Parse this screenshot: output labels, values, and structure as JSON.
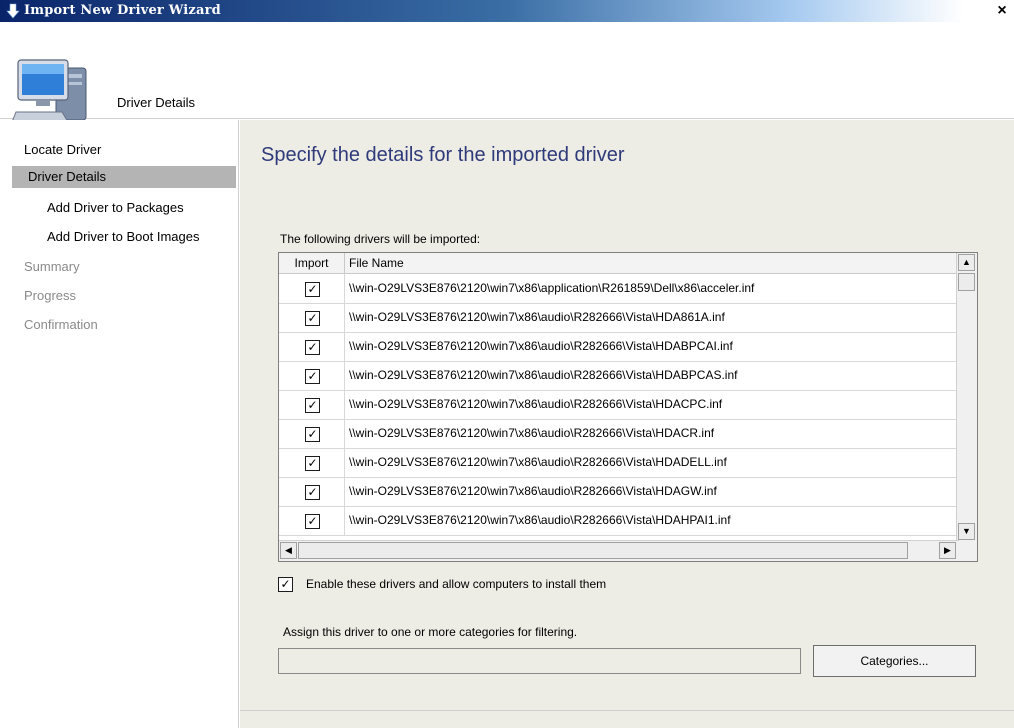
{
  "window": {
    "title": "Import New Driver Wizard",
    "close_glyph": "×",
    "title_icon": "arrow-icon"
  },
  "header": {
    "title": "Driver Details",
    "icon": "computer-icon"
  },
  "sidebar": {
    "items": [
      {
        "label": "Locate Driver",
        "state": "done"
      },
      {
        "label": "Driver Details",
        "state": "selected"
      },
      {
        "label": "Add Driver to Packages",
        "state": "pending"
      },
      {
        "label": "Add Driver to Boot Images",
        "state": "pending"
      },
      {
        "label": "Summary",
        "state": "disabled"
      },
      {
        "label": "Progress",
        "state": "disabled"
      },
      {
        "label": "Confirmation",
        "state": "disabled"
      }
    ]
  },
  "main": {
    "heading": "Specify the details for the imported driver",
    "drivers_label": "The following drivers will be imported:",
    "table": {
      "columns": [
        "Import",
        "File Name"
      ],
      "rows": [
        {
          "checked": "✓",
          "file": "\\\\win-O29LVS3E876\\2120\\win7\\x86\\application\\R261859\\Dell\\x86\\acceler.inf"
        },
        {
          "checked": "✓",
          "file": "\\\\win-O29LVS3E876\\2120\\win7\\x86\\audio\\R282666\\Vista\\HDA861A.inf"
        },
        {
          "checked": "✓",
          "file": "\\\\win-O29LVS3E876\\2120\\win7\\x86\\audio\\R282666\\Vista\\HDABPCAI.inf"
        },
        {
          "checked": "✓",
          "file": "\\\\win-O29LVS3E876\\2120\\win7\\x86\\audio\\R282666\\Vista\\HDABPCAS.inf"
        },
        {
          "checked": "✓",
          "file": "\\\\win-O29LVS3E876\\2120\\win7\\x86\\audio\\R282666\\Vista\\HDACPC.inf"
        },
        {
          "checked": "✓",
          "file": "\\\\win-O29LVS3E876\\2120\\win7\\x86\\audio\\R282666\\Vista\\HDACR.inf"
        },
        {
          "checked": "✓",
          "file": "\\\\win-O29LVS3E876\\2120\\win7\\x86\\audio\\R282666\\Vista\\HDADELL.inf"
        },
        {
          "checked": "✓",
          "file": "\\\\win-O29LVS3E876\\2120\\win7\\x86\\audio\\R282666\\Vista\\HDAGW.inf"
        },
        {
          "checked": "✓",
          "file": "\\\\win-O29LVS3E876\\2120\\win7\\x86\\audio\\R282666\\Vista\\HDAHPAI1.inf"
        }
      ]
    },
    "scroll": {
      "up": "▲",
      "down": "▼",
      "left": "◀",
      "right": "▶"
    },
    "enable_checkbox": {
      "checked": "✓",
      "label": "Enable these drivers and allow computers to install them"
    },
    "assign_label": "Assign this driver to one or more categories for filtering.",
    "categories_value": "",
    "categories_button": "Categories..."
  },
  "colors": {
    "titlebar_start": "#0a246a",
    "heading": "#2e3a7a",
    "panel_bg": "#eeede5",
    "selected_nav": "#b4b4b4",
    "dim_text": "#8a8a8a"
  }
}
